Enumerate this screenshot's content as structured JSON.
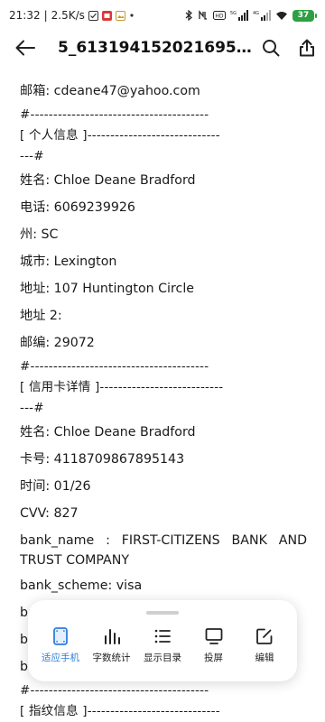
{
  "status_bar": {
    "time": "21:32",
    "net_speed": "2.5K/s",
    "signal_1": "5G",
    "signal_2": "4G",
    "battery": "37"
  },
  "header": {
    "title": "5_613194152021695..."
  },
  "lines": {
    "email": "邮箱: cdeane47@yahoo.com",
    "sep1": "#---------------------------------------",
    "section1": "[ 个人信息 ]-----------------------------",
    "section1_cont": "---#",
    "name1": "姓名: Chloe Deane Bradford",
    "phone": "电话: 6069239926",
    "state": "州: SC",
    "city": "城市: Lexington",
    "address": "地址: 107 Huntington Circle",
    "address2": "地址 2:",
    "zip": "邮编: 29072",
    "sep2": "#---------------------------------------",
    "section2": "[ 信用卡详情 ]---------------------------",
    "section2_cont": "---#",
    "name2": "姓名: Chloe Deane Bradford",
    "card": "卡号: 4118709867895143",
    "expiry": "时间: 01/26",
    "cvv": "CVV: 827",
    "bank_name": "bank_name : FIRST-CITIZENS BANK AND TRUST COMPANY",
    "bank_scheme": "bank_scheme: visa",
    "partial1": "ba",
    "partial2": "ba",
    "partial3": "ba",
    "sep3": "#---------------------------------------",
    "section3": "[ 指纹信息 ]-----------------------------"
  },
  "toolbar": {
    "items": [
      {
        "label": "适应手机",
        "icon": "fit-phone-icon",
        "active": true
      },
      {
        "label": "字数统计",
        "icon": "word-count-icon",
        "active": false
      },
      {
        "label": "显示目录",
        "icon": "toc-icon",
        "active": false
      },
      {
        "label": "投屏",
        "icon": "cast-screen-icon",
        "active": false
      },
      {
        "label": "编辑",
        "icon": "edit-icon",
        "active": false
      }
    ]
  },
  "colors": {
    "accent": "#2f7ed8",
    "battery": "#2ea043"
  }
}
